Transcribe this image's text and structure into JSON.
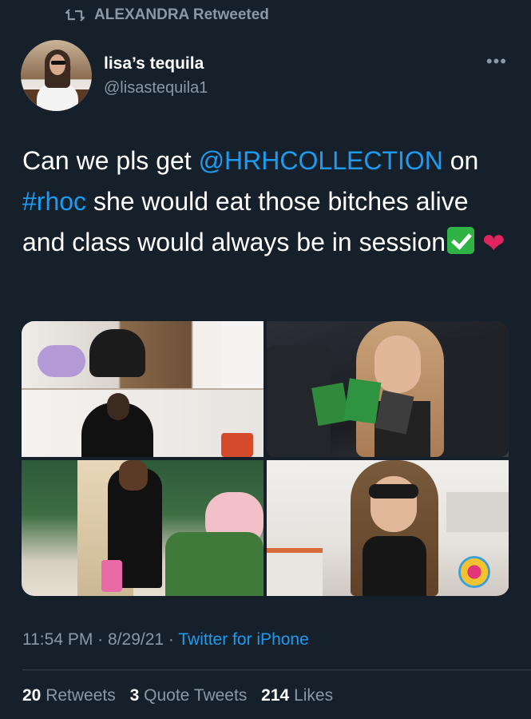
{
  "retweet_header": {
    "icon": "retweet-icon",
    "text": "ALEXANDRA Retweeted"
  },
  "author": {
    "display_name": "lisa’s tequila",
    "handle": "@lisastequila1"
  },
  "more_menu": {
    "icon": "more-dots-icon",
    "label": "•••"
  },
  "tweet": {
    "text_part1": "Can we pls get ",
    "mention": "@HRHCOLLECTION",
    "text_part2": " on ",
    "hashtag": "#rhoc",
    "text_part3": " she would eat those bitches alive and class would always be in session",
    "emoji_1": "check-mark-button-emoji",
    "emoji_2": "red-heart-emoji"
  },
  "media": {
    "count": 4,
    "photos": [
      {
        "name": "photo-1",
        "description_icon": "photo-woman-white-room-icon"
      },
      {
        "name": "photo-2",
        "description_icon": "photo-woman-car-icon"
      },
      {
        "name": "photo-3",
        "description_icon": "photo-woman-garden-icon"
      },
      {
        "name": "photo-4",
        "description_icon": "photo-woman-sunglasses-icon"
      }
    ]
  },
  "meta": {
    "time": "11:54 PM",
    "sep1": " · ",
    "date": "8/29/21",
    "sep2": " · ",
    "source": "Twitter for iPhone"
  },
  "stats": {
    "retweets_count": "20",
    "retweets_label": "Retweets",
    "quotes_count": "3",
    "quotes_label": "Quote Tweets",
    "likes_count": "214",
    "likes_label": "Likes"
  },
  "colors": {
    "background": "#15202b",
    "text": "#ffffff",
    "secondary_text": "#8b98a5",
    "link": "#1d9bf0",
    "divider": "#38444d"
  }
}
